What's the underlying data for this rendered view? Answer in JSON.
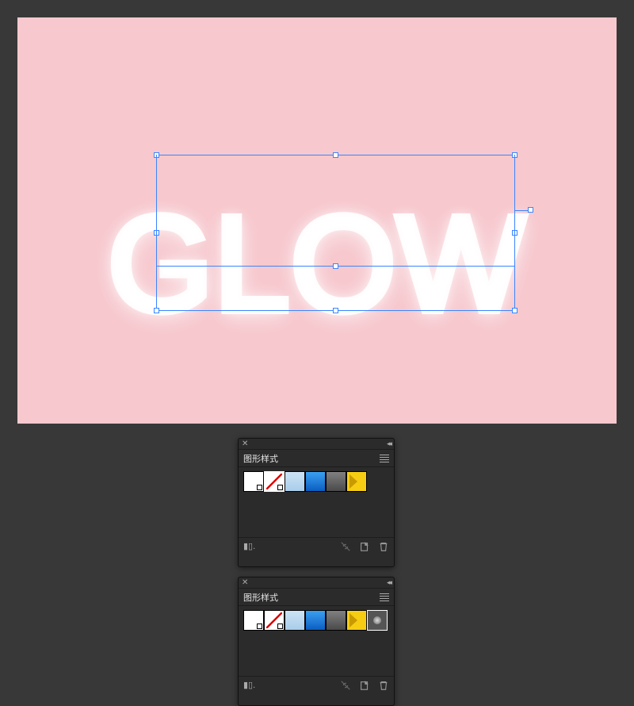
{
  "canvas": {
    "text": "GLOW",
    "bg_color": "#f7c8ce",
    "selection_color": "#3a86ff"
  },
  "panels": [
    {
      "id": "p1",
      "title": "图形样式",
      "swatches": [
        {
          "name": "default-white-1",
          "kind": "white-corner"
        },
        {
          "name": "default-white-2",
          "kind": "white-slash",
          "selected": true
        },
        {
          "name": "light-blue-gradient",
          "kind": "ltblue"
        },
        {
          "name": "blue-gradient",
          "kind": "blue"
        },
        {
          "name": "gray-gradient",
          "kind": "gray"
        },
        {
          "name": "yellow-arrow",
          "kind": "yellow"
        }
      ],
      "footer_left": "▮▯."
    },
    {
      "id": "p2",
      "title": "图形样式",
      "swatches": [
        {
          "name": "default-white-1",
          "kind": "white-corner"
        },
        {
          "name": "default-white-2",
          "kind": "white-slash"
        },
        {
          "name": "light-blue-gradient",
          "kind": "ltblue"
        },
        {
          "name": "blue-gradient",
          "kind": "blue"
        },
        {
          "name": "gray-gradient",
          "kind": "gray"
        },
        {
          "name": "yellow-arrow",
          "kind": "yellow"
        },
        {
          "name": "glow-style",
          "kind": "glow",
          "selected": true
        }
      ],
      "footer_left": "▮▯."
    }
  ]
}
